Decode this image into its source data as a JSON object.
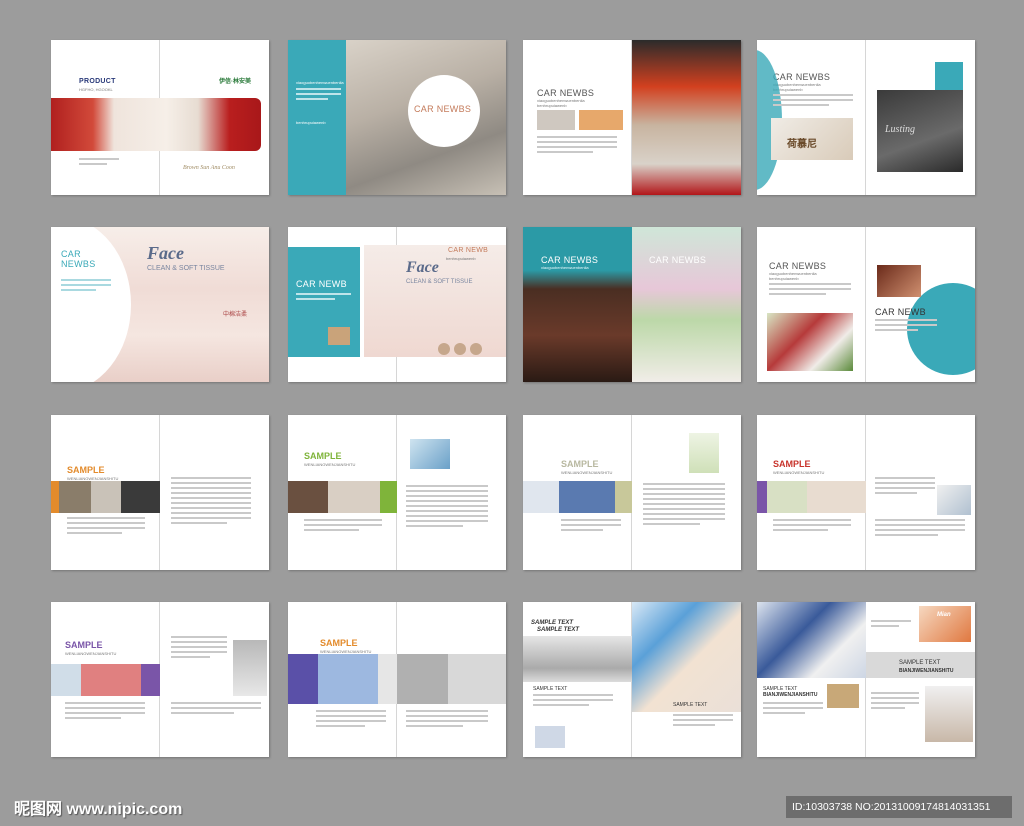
{
  "watermark": {
    "site": "昵图网 www.nipic.com",
    "id_text": "ID:10303738 NO:20131009174814031351"
  },
  "s1": {
    "product": "PRODUCT",
    "product_sub": "HGFHO, HGOOKL",
    "logo": "伊信·林安美",
    "brand": "Brown Sun Anu Coon"
  },
  "s2": {
    "title": "CAR NEWBS",
    "head": "xiaoguobenhenwuenbenlia",
    "head2": "benhrupuiawenb"
  },
  "s3": {
    "title": "CAR NEWBS",
    "head": "xiaoguobenhenwuenbenlia",
    "head2": "benhrupuiawenb"
  },
  "s4": {
    "title": "CAR NEWBS",
    "head": "xiaoguobenhenwuenbenlia",
    "head2": "benhrupuiawenb",
    "logo": "荷慕尼",
    "script": "Lusting"
  },
  "s5": {
    "title1": "CAR",
    "title2": "NEWBS",
    "face": "Face",
    "tag": "CLEAN & SOFT TISSUE",
    "cn": "中棉洁柔"
  },
  "s6": {
    "title": "CAR NEWB",
    "head": "benhrupuiawenb",
    "face": "Face",
    "tag": "CLEAN & SOFT TISSUE",
    "cn": "中棉洁柔"
  },
  "s7": {
    "title_l": "CAR NEWBS",
    "title_r": "CAR NEWBS",
    "head": "xiaoguobenhenwuenbenlia"
  },
  "s8": {
    "title": "CAR NEWBS",
    "title2": "CAR NEWB",
    "head": "xiaoguobenhenwuenbenlia",
    "head2": "benhrupuiawenb"
  },
  "s9": {
    "sample": "SAMPLE",
    "sub": "WENLIANGWENJIANSHITU"
  },
  "s10": {
    "sample": "SAMPLE",
    "sub": "WENLIANGWENJIANSHITU"
  },
  "s11": {
    "sample": "SAMPLE",
    "sub": "WENLIANGWENJIANSHITU"
  },
  "s12": {
    "sample": "SAMPLE",
    "sub": "WENLIANGWENJIANSHITU"
  },
  "s13": {
    "sample": "SAMPLE",
    "sub": "WENLIANGWENJIANSHITU"
  },
  "s14": {
    "sample": "SAMPLE",
    "sub": "WENLIANGWENJIANSHITU"
  },
  "s15": {
    "t1": "SAMPLE TEXT",
    "t2": "SAMPLE TEXT",
    "t3": "SAMPLE TEXT",
    "t4": "SAMPLE TEXT"
  },
  "s16": {
    "t1": "SAMPLE TEXT",
    "t1b": "BIANJIWENJIANSHITU",
    "t2": "SAMPLE TEXT",
    "t2b": "BIANJIWENJIANSHITU",
    "brand": "Mian"
  },
  "colors": {
    "teal": "#3aa9b8",
    "orange": "#e38b2c",
    "green": "#7fb43a",
    "purple": "#7a55a8",
    "red": "#c8332b",
    "bg": "#9c9c9c"
  }
}
